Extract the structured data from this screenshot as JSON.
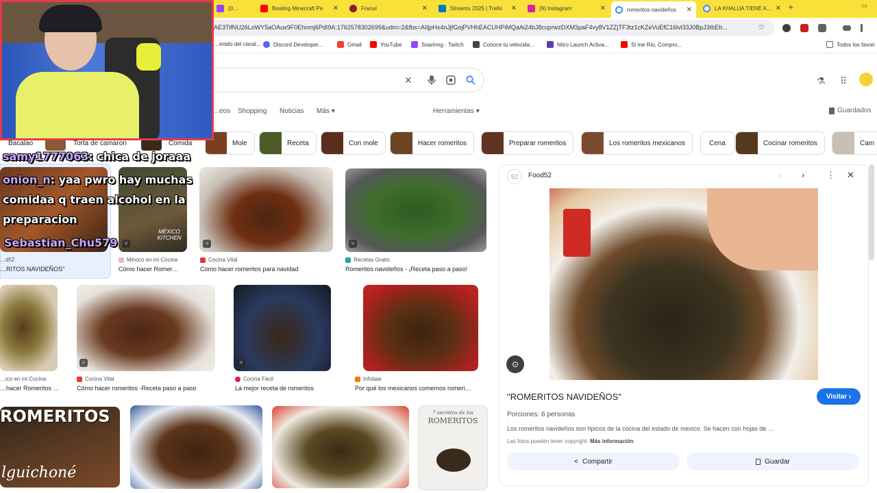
{
  "browser": {
    "tabs": [
      {
        "title": "(0…",
        "active": false
      },
      {
        "title": "Beating Minecraft Pe",
        "active": false
      },
      {
        "title": "Franuí",
        "active": false
      },
      {
        "title": "Streams 2025 | Trello",
        "active": false
      },
      {
        "title": "(9) Instagram",
        "active": false
      },
      {
        "title": "romeritos navideños",
        "active": true
      },
      {
        "title": "LA KHALUA TIENE A…",
        "active": false
      }
    ],
    "url": "AE3TifNU26LoWY5aOAux9F0Ehnmj6PdI9A:1762578302699&udm=2&fbs=AIljpHx4nJjfGojPVHhEACUHPiMQaAi24bJ8cuprwzDXM3paF4vy8V1ZZjTF3tz1cKZeVuEfC16lvl33J0BpJ3tbEb...",
    "bookmarks": [
      "…enido del canal...",
      "Discord Developer...",
      "Gmail",
      "YouTube",
      "Soarinng - Twitch",
      "Conoce tu velocida...",
      "Nitro Launch Activa...",
      "Si me Rio, Compro..."
    ],
    "all_bookmarks": "Todos los favori"
  },
  "google": {
    "nav_tabs": [
      "…eos",
      "Shopping",
      "Noticias",
      "Más",
      "Herramientas"
    ],
    "saved": "Guardados",
    "chips_partial": [
      "Bacalao",
      "Torta de camaron",
      "Comida"
    ],
    "chips": [
      "Mole",
      "Receta",
      "Con mole",
      "Hacer romeritos",
      "Preparar romeritos",
      "Los romeritos mexicanos",
      "Cena",
      "Cocinar romeritos",
      "Cam"
    ]
  },
  "results": {
    "row1": [
      {
        "source": "…d52",
        "caption": "…RITOS NAVIDEÑOS\""
      },
      {
        "source": "México en mi Cocina",
        "caption": "Cómo hacer Romer…"
      },
      {
        "source": "Cocina Vital",
        "caption": "Cómo hacer romeritos para navidad"
      },
      {
        "source": "Recetas Gratis",
        "caption": "Romeritos navideños - ¡Receta paso a paso!"
      }
    ],
    "row2": [
      {
        "source": "…ico en mi Cocina",
        "caption": "…hacer Romeritos …"
      },
      {
        "source": "Cocina Vital",
        "caption": "Cómo hacer romeritos -Receta paso a paso"
      },
      {
        "source": "Cocina Fácil",
        "caption": "La mejor receta de romeritos"
      },
      {
        "source": "Infobae",
        "caption": "Por qué los mexicanos comemos romeri…"
      }
    ],
    "row3_overlay": {
      "title": "ROMERITOS",
      "script": "lguichoné"
    },
    "book_cover": {
      "line1": "7 secretos de los",
      "line2": "ROMERITOS"
    },
    "thumb_watermark": "MÉXICO KITCHEN"
  },
  "chat": [
    {
      "user": "samy1777063",
      "text": ": chica de joraaa"
    },
    {
      "user": "onion_n",
      "text": ": yaa pwro hay muchas"
    },
    {
      "user": "",
      "text": "comidaa q traen alcohol en la"
    },
    {
      "user": "",
      "text": "preparacion"
    },
    {
      "user": "Sebastian_Chu579",
      "text": ""
    }
  ],
  "preview": {
    "site": "Food52",
    "title": "\"ROMERITOS NAVIDEÑOS\"",
    "servings": "Porciones: 6 personas",
    "description": "Los romeritos navideños son típicos de la cocina del estado de mexico. Se hacen con hojas de …",
    "copyright": "Las fotos pueden tener copyright.",
    "more_info": "Más información",
    "visit": "Visitar",
    "share": "Compartir",
    "save": "Guardar"
  },
  "colors": {
    "tabstrip": "#f9e13a",
    "accent": "#1a73e8",
    "webcam_border": "#e33b4b",
    "chat_name": "#c9a8ff"
  }
}
